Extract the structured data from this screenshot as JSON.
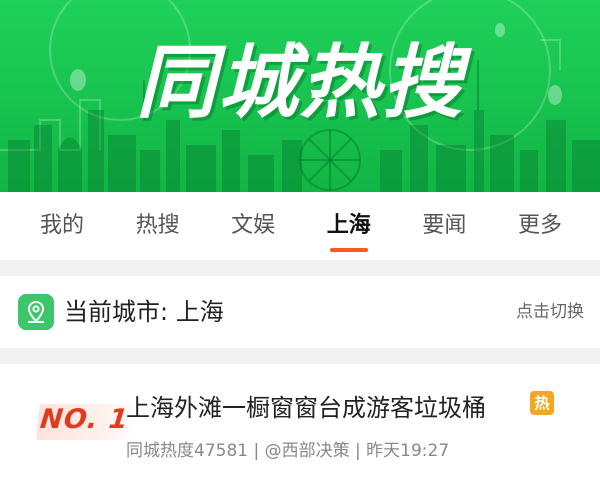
{
  "banner": {
    "title": "同城热搜"
  },
  "tabs": [
    {
      "label": "我的",
      "active": false
    },
    {
      "label": "热搜",
      "active": false
    },
    {
      "label": "文娱",
      "active": false
    },
    {
      "label": "上海",
      "active": true
    },
    {
      "label": "要闻",
      "active": false
    },
    {
      "label": "更多",
      "active": false
    }
  ],
  "city": {
    "label": "当前城市: 上海",
    "switch_label": "点击切换",
    "icon": "location-pin-icon"
  },
  "news": {
    "rank": "NO. 1",
    "title": "上海外滩一橱窗窗台成游客垃圾桶",
    "badge": "热",
    "meta": "同城热度47581 | @西部决策 | 昨天19:27"
  },
  "colors": {
    "banner_green": "#17c24f",
    "tab_indicator": "#ff5a1e",
    "hot_badge": "#f5a623",
    "rank_red": "#e23a1d",
    "city_icon_bg": "#3dc56b"
  }
}
